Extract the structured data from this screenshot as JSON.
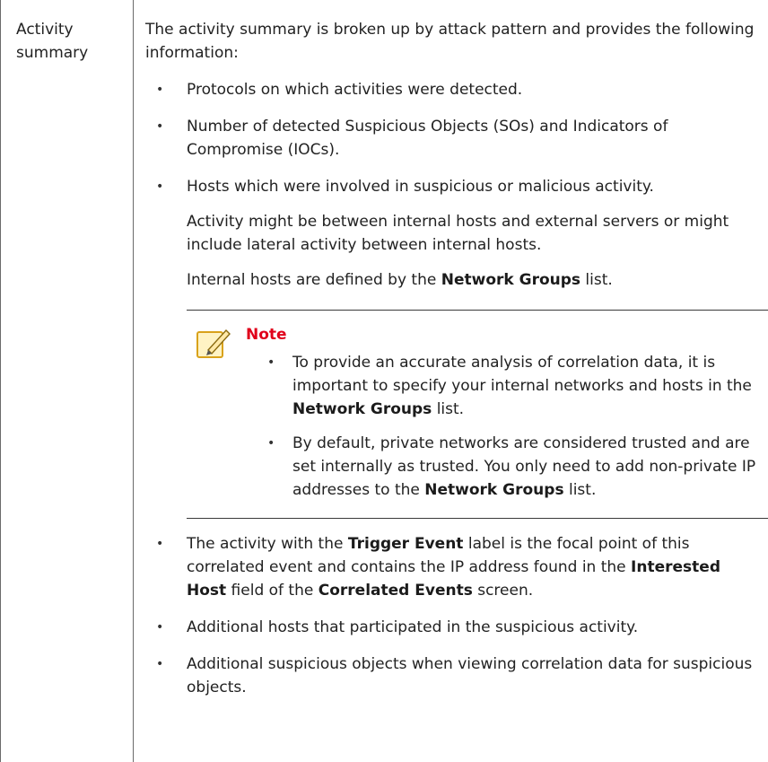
{
  "term": "Activity summary",
  "intro": "The activity summary is broken up by attack pattern and provides the following information:",
  "bullet_glyph": "•",
  "items": {
    "protocols": "Protocols on which activities were detected.",
    "counts": "Number of detected Suspicious Objects (SOs) and Indicators of Compromise (IOCs).",
    "hosts": "Hosts which were involved in suspicious or malicious activity.",
    "hosts_sub1": "Activity might be between internal hosts and external servers or might include lateral activity between internal hosts.",
    "hosts_sub2": {
      "before": "Internal hosts are defined by the ",
      "bold": "Network Groups",
      "after": " list."
    },
    "trigger": {
      "t1": "The activity with the ",
      "b1": "Trigger Event",
      "t2": " label is the focal point of this correlated event and contains the IP address found in the ",
      "b2": "Interested Host",
      "t3": " field of the ",
      "b3": "Correlated Events",
      "t4": " screen."
    },
    "additional_hosts": "Additional hosts that participated in the suspicious activity.",
    "additional_objects": "Additional suspicious objects when viewing correlation data for suspicious objects."
  },
  "note": {
    "icon": "note-pencil-icon",
    "title": "Note",
    "title_color": "#e0001b",
    "item1": {
      "before": "To provide an accurate analysis of correlation data, it is important to specify your internal networks and hosts in the ",
      "bold": "Network Groups",
      "after": " list."
    },
    "item2": {
      "before": "By default, private networks are considered trusted and are set internally as trusted. You only need to add non-private IP addresses to the ",
      "bold": "Network Groups",
      "after": " list."
    }
  }
}
